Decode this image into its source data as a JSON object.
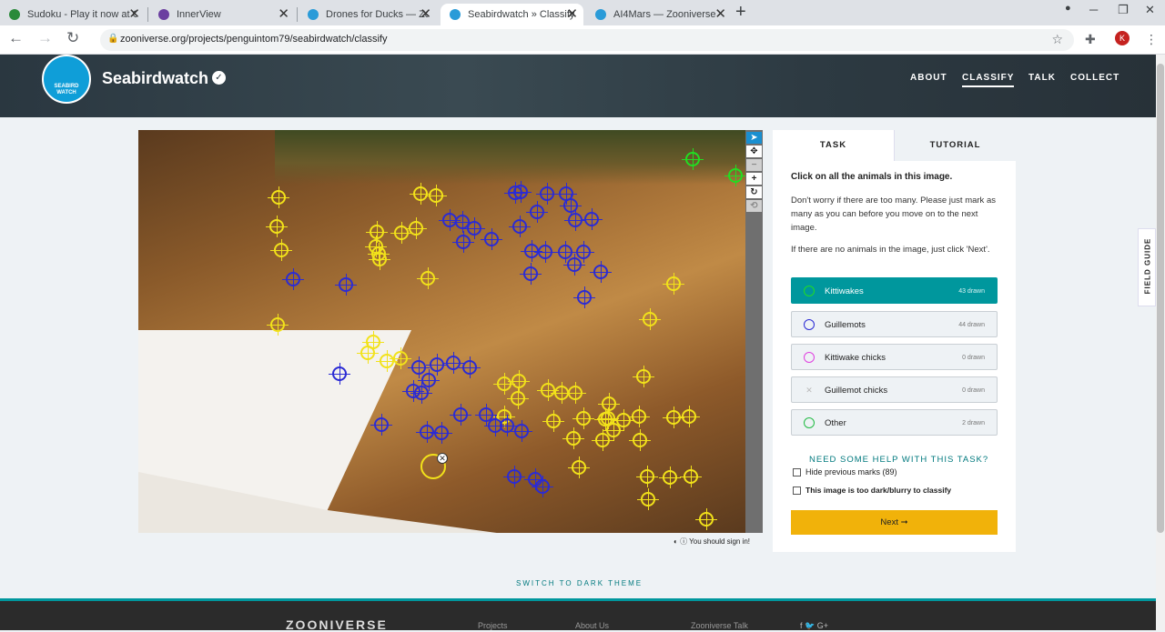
{
  "browser": {
    "tabs": [
      {
        "title": "Sudoku - Play it now at Coolm",
        "fav": "#2a8a3a"
      },
      {
        "title": "InnerView",
        "fav": "#6b3fa0"
      },
      {
        "title": "Drones for Ducks — Zooniverse",
        "fav": "#2a9bd8"
      },
      {
        "title": "Seabirdwatch » Classify — Zoo",
        "fav": "#2a9bd8"
      },
      {
        "title": "AI4Mars — Zooniverse",
        "fav": "#2a9bd8"
      }
    ],
    "url": "zooniverse.org/projects/penguintom79/seabirdwatch/classify",
    "profile_initial": "K"
  },
  "header": {
    "project": "Seabirdwatch",
    "logo_text": "SEABIRD WATCH",
    "nav": [
      "ABOUT",
      "CLASSIFY",
      "TALK",
      "COLLECT"
    ]
  },
  "subject": {
    "signin_note": "You should sign in!"
  },
  "task": {
    "tabs": [
      "TASK",
      "TUTORIAL"
    ],
    "question": "Click on all the animals in this image.",
    "help_1": "Don't worry if there are too many. Please just mark as many as you can before you move on to the next image.",
    "help_2": "If there are no animals in the image, just click 'Next'.",
    "tools": [
      {
        "label": "Kittiwakes",
        "count": "43 drawn",
        "color": "#22dd22"
      },
      {
        "label": "Guillemots",
        "count": "44 drawn",
        "color": "#2b2bd4"
      },
      {
        "label": "Kittiwake chicks",
        "count": "0 drawn",
        "color": "#e040e0"
      },
      {
        "label": "Guillemot chicks",
        "count": "0 drawn",
        "color": "#bbbbbb"
      },
      {
        "label": "Other",
        "count": "2 drawn",
        "color": "#22bb44"
      }
    ],
    "need_help": "NEED SOME HELP WITH THIS TASK?",
    "hide_marks": "Hide previous marks (89)",
    "too_dark": "This image is too dark/blurry to classify",
    "next": "Next ➞"
  },
  "field_guide": "FIELD GUIDE",
  "dark_theme": "SWITCH TO DARK THEME",
  "footer": {
    "logo": "ZOONIVERSE",
    "links": [
      "Projects",
      "About Us",
      "Zooniverse Talk"
    ],
    "social": "f  🐦  G+"
  }
}
